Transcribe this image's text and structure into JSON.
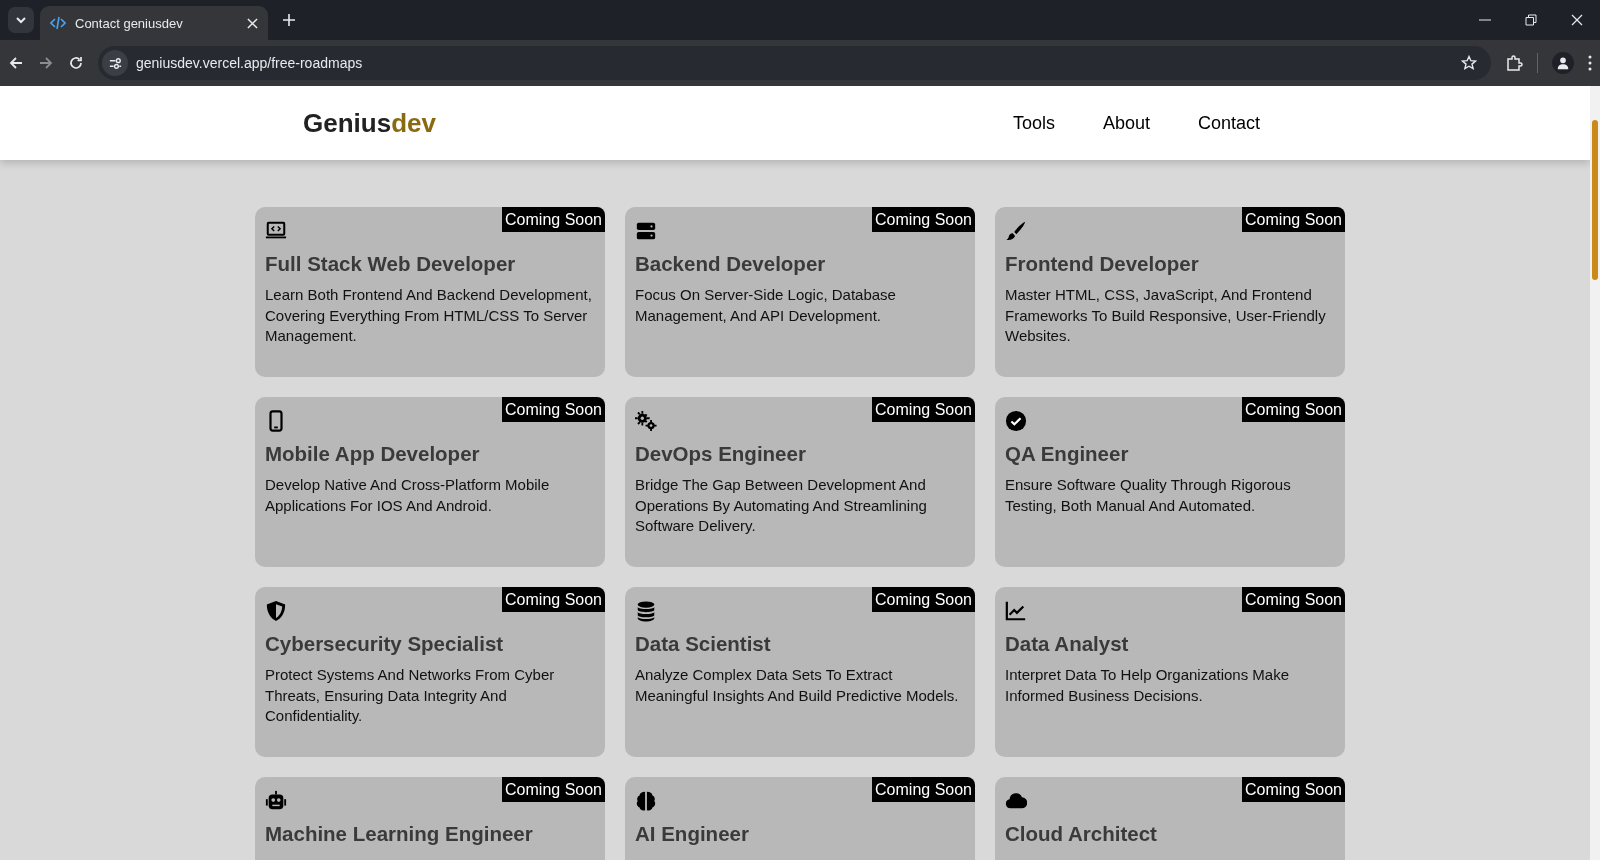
{
  "browser": {
    "tab_title": "Contact geniusdev",
    "url": "geniusdev.vercel.app/free-roadmaps"
  },
  "header": {
    "logo": {
      "prefix": "Genius",
      "suffix": "dev"
    },
    "nav": [
      "Tools",
      "About",
      "Contact"
    ]
  },
  "cards": [
    {
      "title": "Full Stack Web Developer",
      "badge": "Coming Soon",
      "description": "Learn Both Frontend And Backend Development, Covering Everything From HTML/CSS To Server Management."
    },
    {
      "title": "Backend Developer",
      "badge": "Coming Soon",
      "description": "Focus On Server-Side Logic, Database Management, And API Development."
    },
    {
      "title": "Frontend Developer",
      "badge": "Coming Soon",
      "description": "Master HTML, CSS, JavaScript, And Frontend Frameworks To Build Responsive, User-Friendly Websites."
    },
    {
      "title": "Mobile App Developer",
      "badge": "Coming Soon",
      "description": "Develop Native And Cross-Platform Mobile Applications For IOS And Android."
    },
    {
      "title": "DevOps Engineer",
      "badge": "Coming Soon",
      "description": "Bridge The Gap Between Development And Operations By Automating And Streamlining Software Delivery."
    },
    {
      "title": "QA Engineer",
      "badge": "Coming Soon",
      "description": "Ensure Software Quality Through Rigorous Testing, Both Manual And Automated."
    },
    {
      "title": "Cybersecurity Specialist",
      "badge": "Coming Soon",
      "description": "Protect Systems And Networks From Cyber Threats, Ensuring Data Integrity And Confidentiality."
    },
    {
      "title": "Data Scientist",
      "badge": "Coming Soon",
      "description": "Analyze Complex Data Sets To Extract Meaningful Insights And Build Predictive Models."
    },
    {
      "title": "Data Analyst",
      "badge": "Coming Soon",
      "description": "Interpret Data To Help Organizations Make Informed Business Decisions."
    },
    {
      "title": "Machine Learning Engineer",
      "badge": "Coming Soon"
    },
    {
      "title": "AI Engineer",
      "badge": "Coming Soon"
    },
    {
      "title": "Cloud Architect",
      "badge": "Coming Soon"
    }
  ]
}
